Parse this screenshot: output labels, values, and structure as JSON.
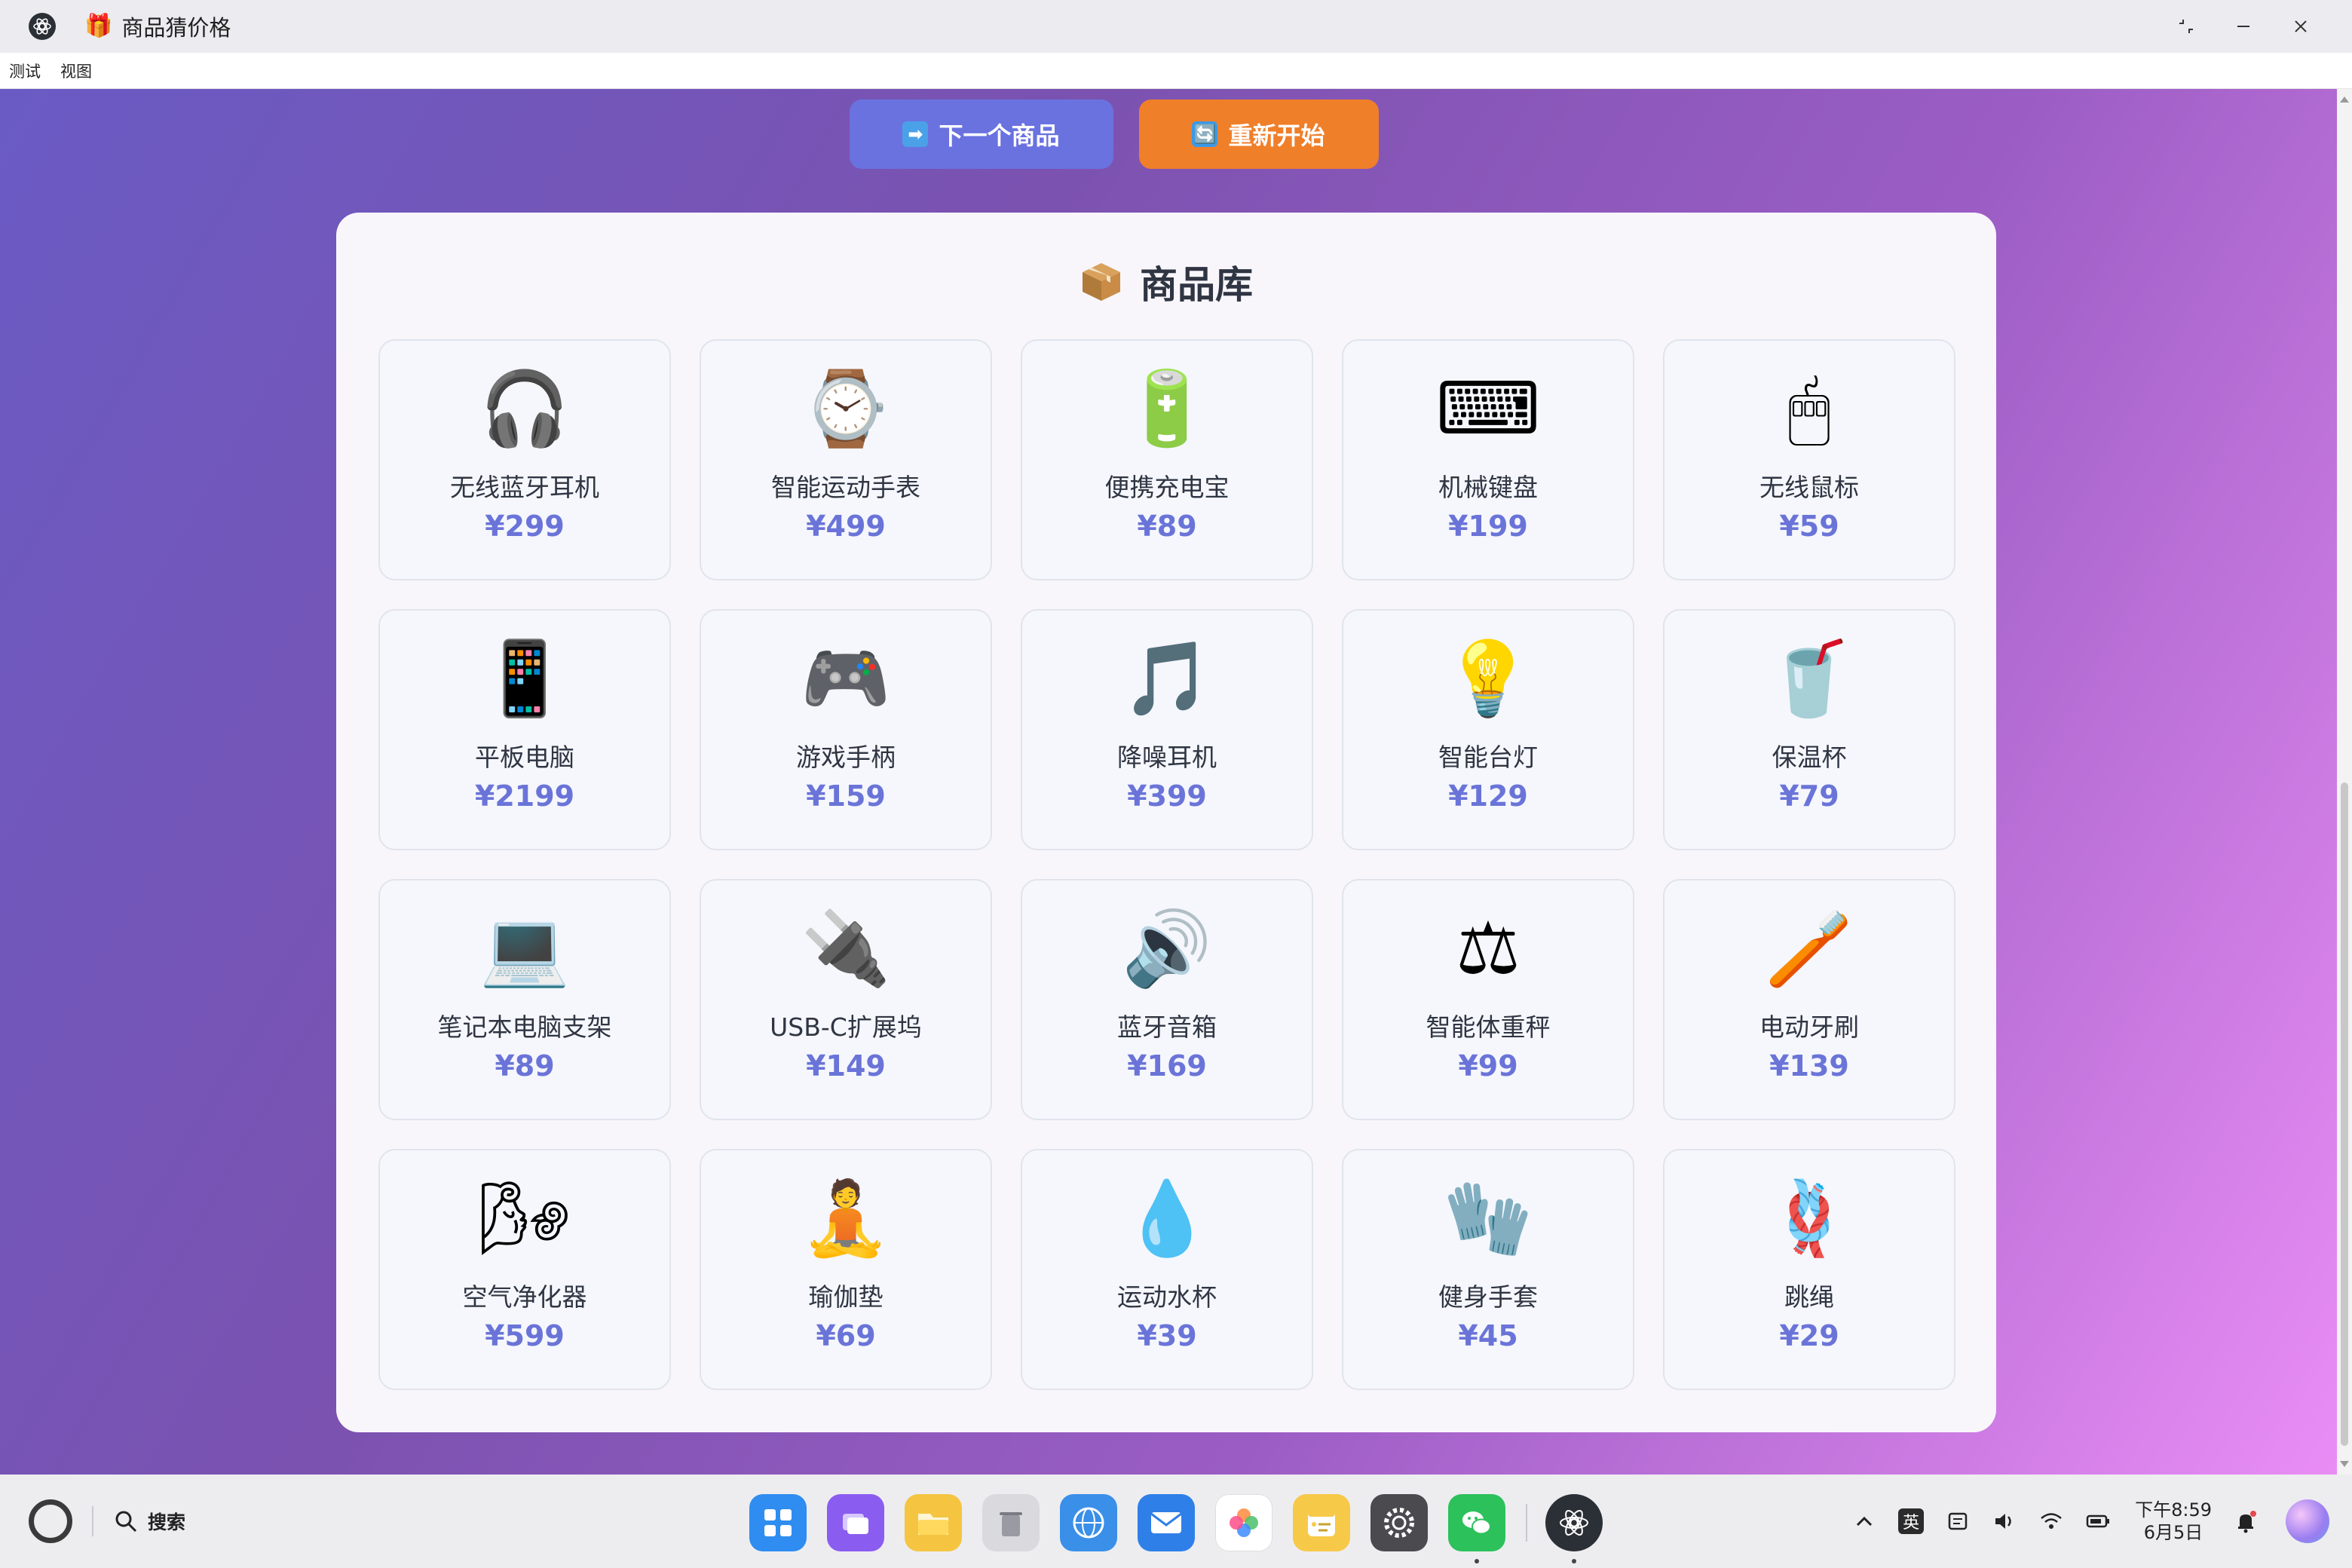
{
  "window": {
    "title_emoji": "🎁",
    "title": "商品猜价格"
  },
  "menu": [
    "测试",
    "视图"
  ],
  "buttons": {
    "next_icon": "➡",
    "next_label": "下一个商品",
    "restart_icon": "🔄",
    "restart_label": "重新开始"
  },
  "panel": {
    "title": "商品库",
    "title_icon": "package-icon"
  },
  "products": [
    {
      "emoji": "🎧",
      "name": "无线蓝牙耳机",
      "price": "¥299"
    },
    {
      "emoji": "⌚",
      "name": "智能运动手表",
      "price": "¥499"
    },
    {
      "emoji": "🔋",
      "name": "便携充电宝",
      "price": "¥89"
    },
    {
      "emoji": "⌨",
      "name": "机械键盘",
      "price": "¥199"
    },
    {
      "emoji": "🖱",
      "name": "无线鼠标",
      "price": "¥59"
    },
    {
      "emoji": "📱",
      "name": "平板电脑",
      "price": "¥2199"
    },
    {
      "emoji": "🎮",
      "name": "游戏手柄",
      "price": "¥159"
    },
    {
      "emoji": "🎵",
      "name": "降噪耳机",
      "price": "¥399"
    },
    {
      "emoji": "💡",
      "name": "智能台灯",
      "price": "¥129"
    },
    {
      "emoji": "🥤",
      "name": "保温杯",
      "price": "¥79"
    },
    {
      "emoji": "💻",
      "name": "笔记本电脑支架",
      "price": "¥89"
    },
    {
      "emoji": "🔌",
      "name": "USB-C扩展坞",
      "price": "¥149"
    },
    {
      "emoji": "🔊",
      "name": "蓝牙音箱",
      "price": "¥169"
    },
    {
      "emoji": "⚖",
      "name": "智能体重秤",
      "price": "¥99"
    },
    {
      "emoji": "🪥",
      "name": "电动牙刷",
      "price": "¥139"
    },
    {
      "emoji": "🌬",
      "name": "空气净化器",
      "price": "¥599"
    },
    {
      "emoji": "🧘",
      "name": "瑜伽垫",
      "price": "¥69"
    },
    {
      "emoji": "💧",
      "name": "运动水杯",
      "price": "¥39"
    },
    {
      "emoji": "🧤",
      "name": "健身手套",
      "price": "¥45"
    },
    {
      "emoji": "🪢",
      "name": "跳绳",
      "price": "¥29"
    }
  ],
  "taskbar": {
    "search_label": "搜索",
    "ime": "英",
    "time": "下午8:59",
    "date": "6月5日",
    "apps": [
      {
        "name": "launcher-icon",
        "color": "#2f8cf0"
      },
      {
        "name": "multitask-icon",
        "color": "#8a5cf0"
      },
      {
        "name": "files-icon",
        "color": "#f5c542"
      },
      {
        "name": "trash-icon",
        "color": "#d9d9de"
      },
      {
        "name": "browser-icon",
        "color": "#3a8fe8"
      },
      {
        "name": "mail-icon",
        "color": "#2f7fe8"
      },
      {
        "name": "photos-icon",
        "color": "#ffffff"
      },
      {
        "name": "notes-icon",
        "color": "#f7c948"
      },
      {
        "name": "settings-icon",
        "color": "#4a4a4f"
      },
      {
        "name": "wechat-icon",
        "color": "#2dc15b"
      }
    ]
  },
  "colors": {
    "accent_blue": "#6a72e0",
    "accent_orange": "#f07f2a",
    "price": "#6a74d8"
  }
}
